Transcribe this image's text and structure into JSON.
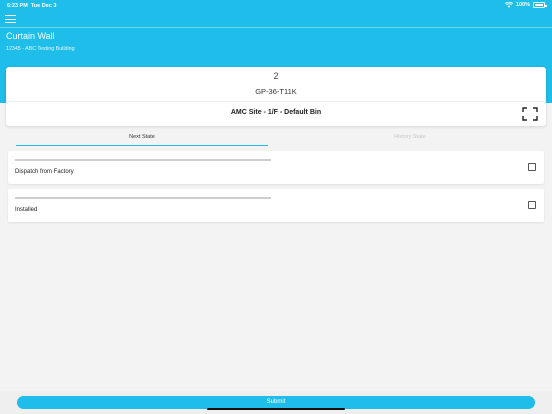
{
  "status_bar": {
    "time": "6:23 PM",
    "date": "Tue Dec 3",
    "battery": "100%",
    "icons": [
      "wifi-icon",
      "battery-icon"
    ]
  },
  "header": {
    "menu_icon": "hamburger-menu-icon",
    "title": "Curtain Wall",
    "subtitle": "12345 - ABC Testing Building"
  },
  "card": {
    "quantity": "2",
    "part_number": "GP-36-T11K",
    "location": "AMC Site - 1/F - Default Bin",
    "scan_icon": "scan-frame-icon"
  },
  "tabs": [
    {
      "label": "Next State",
      "active": true
    },
    {
      "label": "History State",
      "active": false
    }
  ],
  "states": [
    {
      "label": "Dispatch from Factory",
      "checked": false
    },
    {
      "label": "Installed",
      "checked": false
    }
  ],
  "footer": {
    "submit_label": "Submit"
  },
  "colors": {
    "accent": "#1fbde9",
    "background": "#f3f3f3"
  }
}
